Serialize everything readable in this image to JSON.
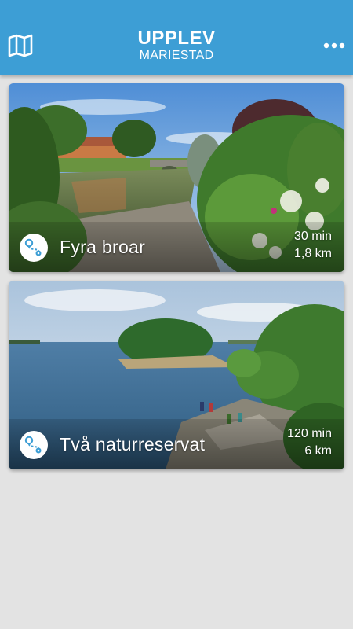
{
  "header": {
    "title": "UPPLEV",
    "subtitle": "MARIESTAD",
    "map_icon": "map-icon",
    "menu_icon": "more-dots-icon",
    "background_color": "#3d9ed5"
  },
  "routes": [
    {
      "title": "Fyra broar",
      "duration": "30 min",
      "distance": "1,8 km",
      "icon": "route-icon"
    },
    {
      "title": "Två naturreservat",
      "duration": "120 min",
      "distance": "6 km",
      "icon": "route-icon"
    }
  ]
}
